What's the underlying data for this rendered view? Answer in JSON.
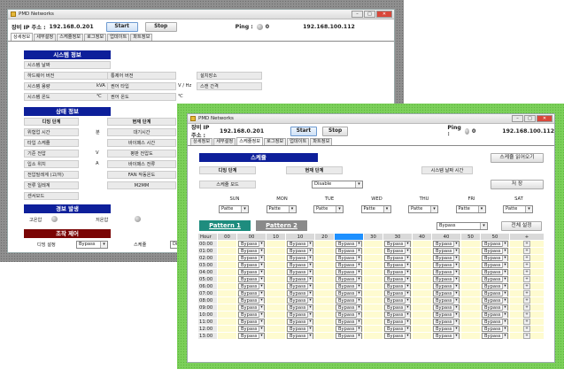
{
  "back": {
    "title": "PMD Networks",
    "ip_label": "장비 IP 주소 :",
    "ip_value": "192.168.0.201",
    "start": "Start",
    "stop": "Stop",
    "ping_label": "Ping :",
    "ping_count": "0",
    "ip_right": "192.168.100.112",
    "tabs": [
      "상세정보",
      "세부설정",
      "스케쥴정보",
      "로그정보",
      "업데이트",
      "파트정보"
    ],
    "sys_title": "시스템 정보",
    "sys_rows": [
      {
        "a": "시스템 날짜"
      },
      {
        "a": "하드웨어 버전",
        "b": "통제어 버전",
        "c": "설치장소"
      },
      {
        "a": "시스템 용량",
        "u1": "kVA",
        "b": "권어 타입",
        "u2": "V / Hz",
        "c": "스캔 간격"
      },
      {
        "a": "시스템 온도",
        "u1": "℃",
        "b": "권어 온도",
        "u2": "℃"
      }
    ],
    "state_title": "상태 정보",
    "state_left": [
      "디밍 단계",
      "위험업 시간",
      "타입 스케쥴",
      "기준 전압",
      "입소 위치",
      "전압밀레계 (고/저)",
      "전류 일레계",
      "센서모드"
    ],
    "state_units": [
      "",
      "분",
      "",
      "V",
      "A",
      "",
      "",
      ""
    ],
    "state_mid": [
      "현재 단계",
      "대기시간",
      "바이패스 시간",
      "평판 전압도",
      "바이패스 전류",
      "FAN 작동온도",
      "M2MM"
    ],
    "alarm_title": "경보 발생",
    "alarm1": "고온압",
    "alarm2": "저온압",
    "ctrl_title": "조작 제어",
    "ctrl_label": "디밍 설정",
    "ctrl_value": "Bypass",
    "ctrl_label2": "스케쥴",
    "ctrl_value2": "Disab"
  },
  "front": {
    "title": "PMD Networks",
    "ip_label": "장비 IP 주소 :",
    "ip_value": "192.168.0.201",
    "start": "Start",
    "stop": "Stop",
    "ping_label": "Ping :",
    "ping_count": "0",
    "ip_right": "192.168.100.112",
    "tabs": [
      "상세정보",
      "세부설정",
      "스케쥴정보",
      "로그정보",
      "업데이트",
      "파트정보"
    ],
    "schedule_title": "스케쥴",
    "read_button": "스케쥴 읽어오기",
    "dim_label": "디밍 단계",
    "current_label": "현재 단계",
    "sys_time_label": "시스템 날짜 시간",
    "mode_label": "스케쥴 모드",
    "mode_value": "Disable",
    "save_button": "저 장",
    "days": [
      "SUN",
      "MON",
      "TUE",
      "WED",
      "THU",
      "FRI",
      "SAT"
    ],
    "pattern_value": "Patte",
    "pattern1": "Pattern 1",
    "pattern2": "Pattern 2",
    "all_value": "Bypass",
    "all_button": "전체 설정",
    "hour_header": "Hour",
    "minute_cols": [
      "00",
      "10",
      "20",
      "30",
      "40",
      "50"
    ],
    "hours": [
      "00:00",
      "01:00",
      "02:00",
      "03:00",
      "04:00",
      "05:00",
      "06:00",
      "07:00",
      "08:00",
      "09:00",
      "10:00",
      "11:00",
      "12:00",
      "13:00"
    ],
    "cell_value": "Bypass",
    "plus": "+"
  },
  "colors": {
    "section_blue": "#0d1f9a",
    "section_red": "#7a0505",
    "pattern_active": "#1e8c7e",
    "pattern_inactive": "#8a8a8a",
    "grid_yellow": "#fefbd0",
    "back_frame": "#8f8f8f",
    "front_frame": "#7cd05a"
  }
}
